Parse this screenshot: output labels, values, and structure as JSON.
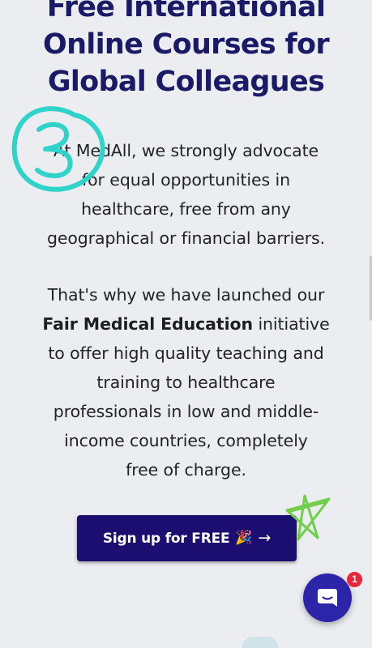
{
  "hero": {
    "title_lines": [
      "Free International",
      "Online Courses for",
      "Global Colleagues"
    ]
  },
  "body": {
    "paragraph1_lines": [
      "At MedAll, we strongly advocate",
      "for equal opportunities in",
      "healthcare, free from any",
      "geographical or financial barriers."
    ],
    "paragraph2": {
      "line1": "That's why we have launched our",
      "bold": "Fair Medical Education",
      "after_bold": " initiative",
      "lines_rest": [
        "to offer high quality teaching and",
        "training to healthcare",
        "professionals in low and middle-",
        "income countries, completely",
        "free of charge."
      ]
    }
  },
  "cta": {
    "label": "Sign up for FREE",
    "party_emoji": "🎉",
    "arrow": "→"
  },
  "chat": {
    "icon": "chat-bubble-icon",
    "unread_count": "1"
  },
  "colors": {
    "heading": "#1b1a67",
    "cta_background": "#1b0e70",
    "chat_background": "#2c25aa",
    "badge": "#e4283a",
    "teal_ink": "#2fd3ca",
    "green_ink": "#6fcf4a",
    "page_background": "#ecedf0"
  },
  "annotations": {
    "teal_scribble": "handwritten-number-3",
    "green_scribble": "handwritten-star"
  }
}
